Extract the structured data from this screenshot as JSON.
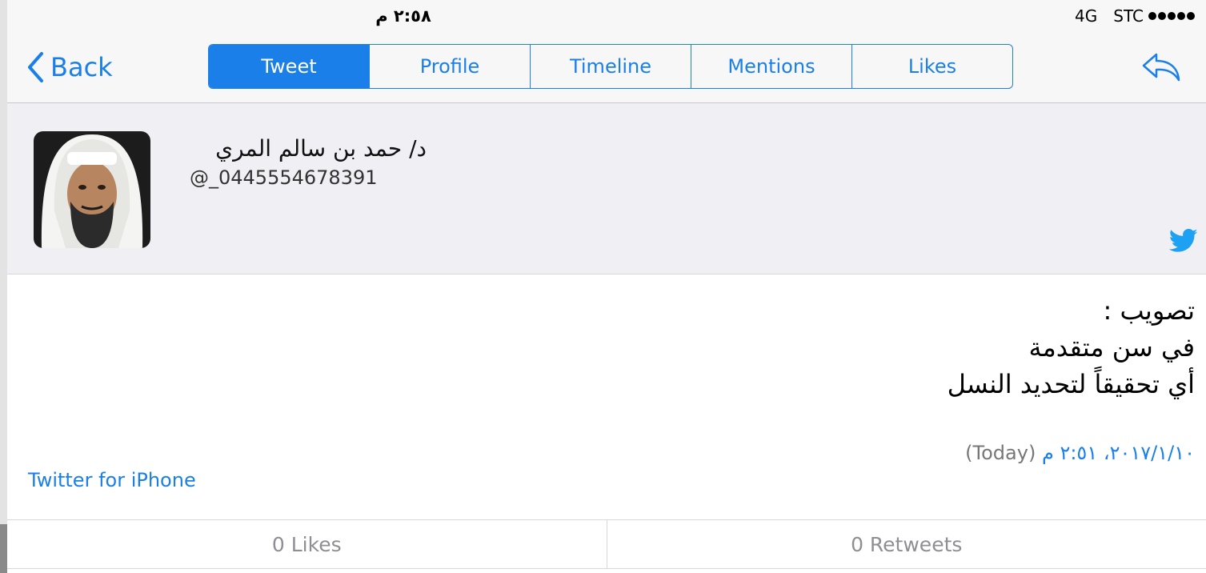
{
  "status_bar": {
    "time": "٢:٥٨ م",
    "network": "4G",
    "carrier": "STC",
    "signal_bars": 5
  },
  "nav": {
    "back_label": "Back",
    "tabs": [
      {
        "label": "Tweet",
        "active": true
      },
      {
        "label": "Profile",
        "active": false
      },
      {
        "label": "Timeline",
        "active": false
      },
      {
        "label": "Mentions",
        "active": false
      },
      {
        "label": "Likes",
        "active": false
      }
    ],
    "reply_icon": "reply-arrow-icon"
  },
  "author": {
    "name": "د/ حمد بن سالم المري",
    "handle": "@_0445554678391",
    "avatar_icon": "avatar"
  },
  "tweet": {
    "lines": [
      "تصويب :",
      "في سن متقدمة",
      "أي تحقيقاً لتحديد النسل"
    ],
    "date": "٢٠١٧/١/١٠، ٢:٥١ م",
    "relative": "(Today)",
    "source": "Twitter for iPhone"
  },
  "stats": {
    "likes": "0 Likes",
    "retweets": "0 Retweets"
  },
  "colors": {
    "accent": "#1a7fe8",
    "header_bg": "#efeff4",
    "bar_bg": "#f7f7f7",
    "muted": "#8e8e93"
  }
}
